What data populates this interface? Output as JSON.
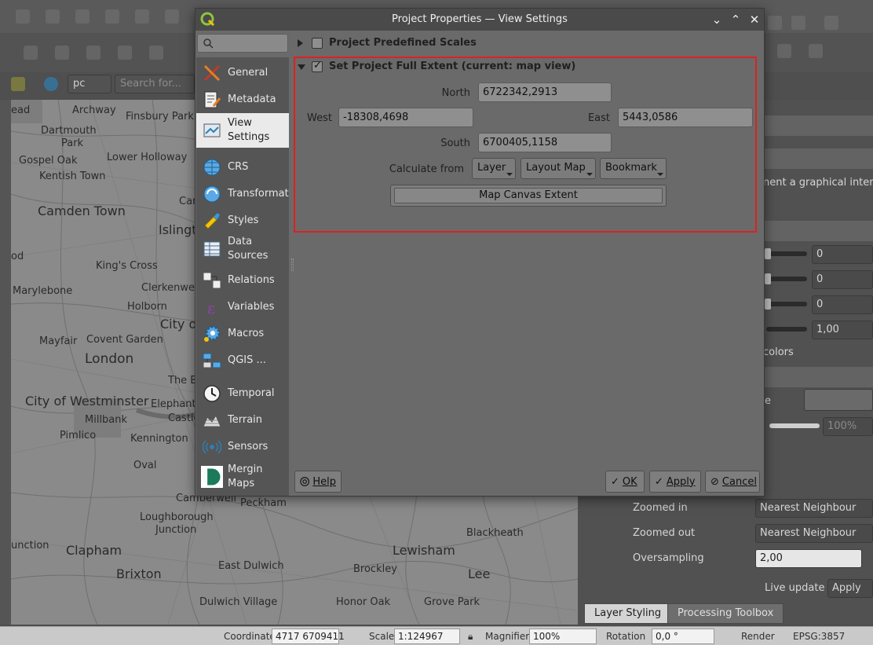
{
  "background": {
    "map_labels": [
      {
        "text": "Archway"
      },
      {
        "text": "Finsbury Park"
      },
      {
        "text": "Dartmouth"
      },
      {
        "text": "Park"
      },
      {
        "text": "Gospel Oak"
      },
      {
        "text": "Lower Holloway"
      },
      {
        "text": "Kentish Town"
      },
      {
        "text": "Camden Town"
      },
      {
        "text": "Islingt"
      },
      {
        "text": "King's Cross"
      },
      {
        "text": "Marylebone"
      },
      {
        "text": "Clerkenwell"
      },
      {
        "text": "Holborn"
      },
      {
        "text": "City o"
      },
      {
        "text": "Mayfair"
      },
      {
        "text": "Covent Garden"
      },
      {
        "text": "London"
      },
      {
        "text": "The B"
      },
      {
        "text": "City of Westminster"
      },
      {
        "text": "Elephant"
      },
      {
        "text": "Millbank"
      },
      {
        "text": "Castle"
      },
      {
        "text": "Pimlico"
      },
      {
        "text": "Kennington"
      },
      {
        "text": "Oval"
      },
      {
        "text": "Camberwell"
      },
      {
        "text": "Peckham"
      },
      {
        "text": "Loughborough"
      },
      {
        "text": "Junction"
      },
      {
        "text": "Clapham"
      },
      {
        "text": "Brixton"
      },
      {
        "text": "East Dulwich"
      },
      {
        "text": "Brockley"
      },
      {
        "text": "Dulwich Village"
      },
      {
        "text": "Honor Oak"
      },
      {
        "text": "Lewisham"
      },
      {
        "text": "Blackheath"
      },
      {
        "text": "Lee"
      },
      {
        "text": "Grove Park"
      },
      {
        "text": "unction"
      },
      {
        "text": "ead"
      },
      {
        "text": "od"
      },
      {
        "text": "Car"
      }
    ],
    "toolbar_combo": "pc",
    "search_placeholder": "Search for...",
    "right_panel": {
      "snippet_text": "nent a graphical interfa",
      "slider_values": [
        "0",
        "0",
        "0",
        "1,00"
      ],
      "colors_text": "colors",
      "e_text": "e",
      "percent_value": "100%",
      "resampling": [
        {
          "label": "Zoomed in",
          "value": "Nearest Neighbour"
        },
        {
          "label": "Zoomed out",
          "value": "Nearest Neighbour"
        }
      ],
      "oversampling_label": "Oversampling",
      "oversampling_value": "2,00",
      "live_update_label": "Live update",
      "apply_label": "Apply",
      "tabs": [
        "Layer Styling",
        "Processing Toolbox"
      ]
    },
    "status_bar": {
      "coordinate_label": "Coordinate",
      "coordinate_value": "4717  6709411",
      "scale_label": "Scale",
      "scale_value": "1:124967",
      "magnifier_label": "Magnifier",
      "magnifier_value": "100%",
      "rotation_label": "Rotation",
      "rotation_value": "0,0 °",
      "render_label": "Render",
      "crs_label": "EPSG:3857"
    }
  },
  "dialog": {
    "title": "Project Properties — View Settings",
    "sidebar_items": [
      {
        "label": "General",
        "icon": "general-icon"
      },
      {
        "label": "Metadata",
        "icon": "metadata-icon"
      },
      {
        "label": "View\nSettings",
        "icon": "view-settings-icon",
        "active": true
      },
      {
        "label": "CRS",
        "icon": "crs-icon"
      },
      {
        "label": "Transformat",
        "icon": "transformations-icon"
      },
      {
        "label": "Styles",
        "icon": "styles-icon"
      },
      {
        "label": "Data\nSources",
        "icon": "data-sources-icon"
      },
      {
        "label": "Relations",
        "icon": "relations-icon"
      },
      {
        "label": "Variables",
        "icon": "variables-icon"
      },
      {
        "label": "Macros",
        "icon": "macros-icon"
      },
      {
        "label": "QGIS ...",
        "icon": "qgis-server-icon"
      },
      {
        "label": "Temporal",
        "icon": "temporal-icon"
      },
      {
        "label": "Terrain",
        "icon": "terrain-icon"
      },
      {
        "label": "Sensors",
        "icon": "sensors-icon"
      },
      {
        "label": "Mergin\nMaps",
        "icon": "mergin-maps-icon"
      }
    ],
    "predefined_scales": {
      "label": "Project Predefined Scales",
      "checked": false,
      "expanded": false
    },
    "full_extent": {
      "label": "Set Project Full Extent (current: map view)",
      "checked": true,
      "expanded": true,
      "north_label": "North",
      "north_value": "6722342,2913",
      "west_label": "West",
      "west_value": "-18308,4698",
      "east_label": "East",
      "east_value": "5443,0586",
      "south_label": "South",
      "south_value": "6700405,1158",
      "calculate_from_label": "Calculate from",
      "layer_button": "Layer",
      "layout_map_button": "Layout Map",
      "bookmark_button": "Bookmark",
      "map_canvas_button": "Map Canvas Extent"
    },
    "footer": {
      "help": "Help",
      "ok": "OK",
      "apply": "Apply",
      "cancel": "Cancel"
    }
  },
  "colors": {
    "highlight_frame": "#e02020",
    "active_item_bg": "#eaeaea"
  }
}
